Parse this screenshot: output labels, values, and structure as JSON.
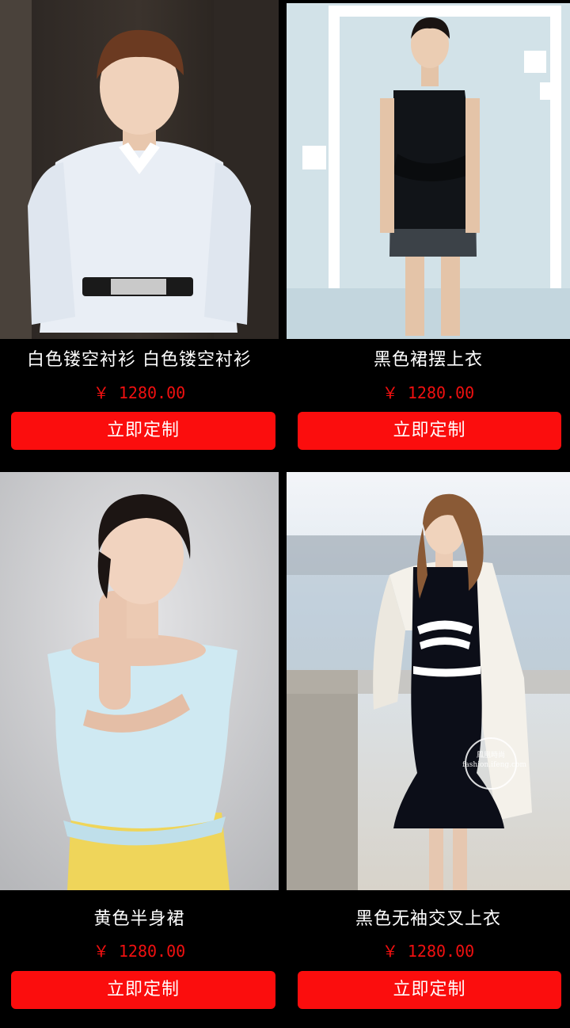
{
  "products": [
    {
      "title": "白色镂空衬衫 白色镂空衬衫",
      "price": "￥ 1280.00",
      "button": "立即定制",
      "image_desc": "woman-white-shirt-photo"
    },
    {
      "title": "黑色裙摆上衣",
      "price": "￥ 1280.00",
      "button": "立即定制",
      "image_desc": "model-black-peplum-dress-photo"
    },
    {
      "title": "黄色半身裙",
      "price": "￥ 1280.00",
      "button": "立即定制",
      "image_desc": "woman-blue-offshoulder-top-photo"
    },
    {
      "title": "黑色无袖交叉上衣",
      "price": "￥ 1280.00",
      "button": "立即定制",
      "image_desc": "woman-black-cross-dress-photo",
      "watermark": "鳳凰時尚 fashion.ifeng.com"
    }
  ],
  "colors": {
    "background": "#000000",
    "price": "#f01010",
    "button": "#fb0d0d",
    "button_text": "#ffffff"
  }
}
